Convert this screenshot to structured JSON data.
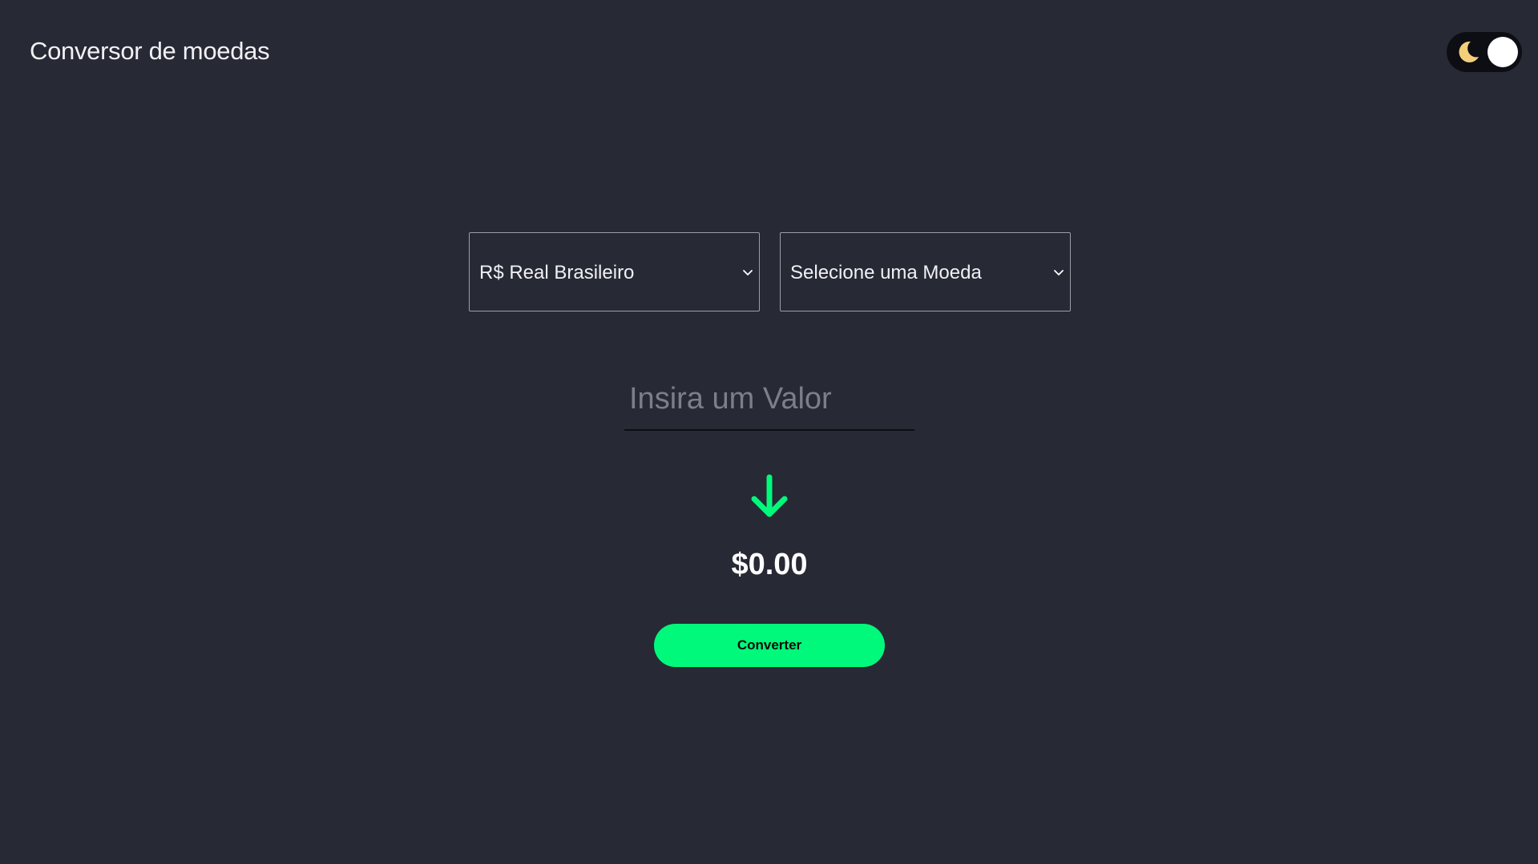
{
  "header": {
    "title": "Conversor de moedas"
  },
  "theme_toggle": {
    "icon": "moon-icon",
    "mode": "dark",
    "moon_color": "#f3cf7a"
  },
  "converter": {
    "from_select": {
      "selected_label": "R$ Real Brasileiro"
    },
    "to_select": {
      "selected_label": "Selecione uma Moeda"
    },
    "amount": {
      "value": "",
      "placeholder": "Insira um Valor"
    },
    "direction_icon": "arrow-down-icon",
    "result": "$0.00",
    "convert_label": "Converter"
  },
  "colors": {
    "background": "#272935",
    "accent": "#00f97b",
    "text": "#ffffff"
  }
}
